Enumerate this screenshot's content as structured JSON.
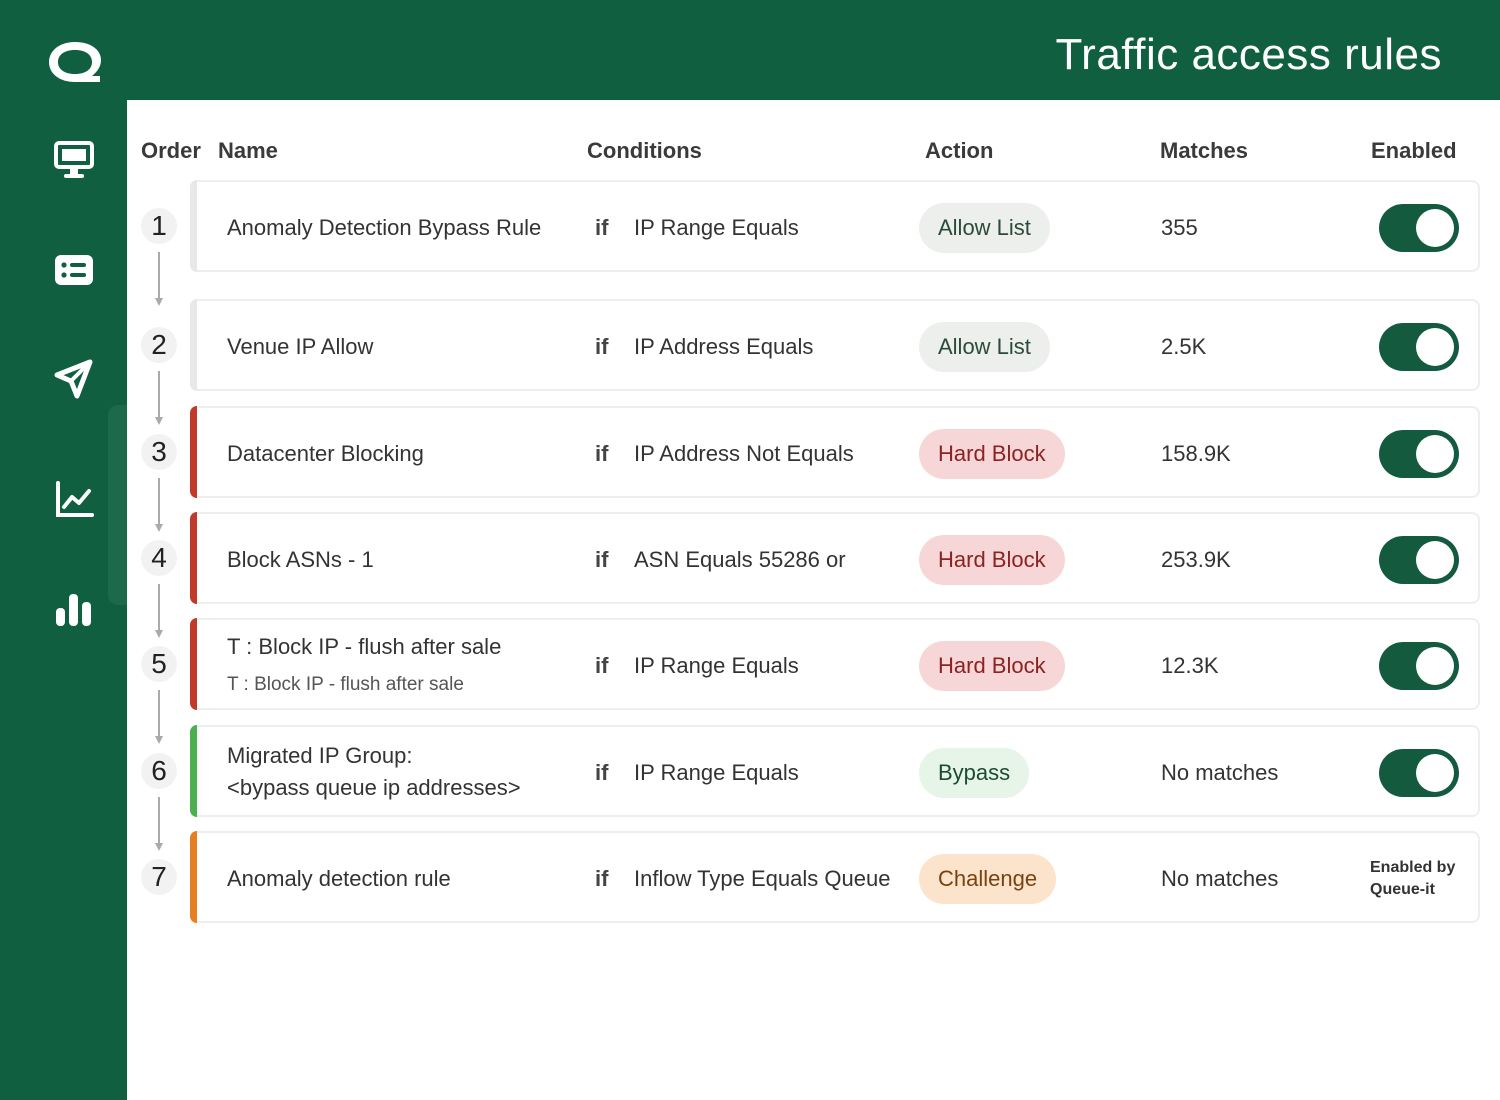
{
  "header": {
    "title": "Traffic access rules"
  },
  "sidebar": {
    "items": [
      {
        "icon": "monitor-icon"
      },
      {
        "icon": "list-icon"
      },
      {
        "icon": "send-icon"
      },
      {
        "icon": "line-chart-icon"
      },
      {
        "icon": "bar-chart-icon"
      }
    ]
  },
  "table": {
    "headers": {
      "order": "Order",
      "name": "Name",
      "conditions": "Conditions",
      "action": "Action",
      "matches": "Matches",
      "enabled": "Enabled"
    },
    "rows": [
      {
        "order": "1",
        "name": "Anomaly Detection Bypass Rule",
        "if": "if",
        "condition": "IP Range Equals",
        "action": "Allow List",
        "matches": "355",
        "enabled": true
      },
      {
        "order": "2",
        "name": "Venue IP Allow",
        "if": "if",
        "condition": "IP Address Equals",
        "action": "Allow List",
        "matches": "2.5K",
        "enabled": true
      },
      {
        "order": "3",
        "name": "Datacenter Blocking",
        "if": "if",
        "condition": "IP Address Not Equals",
        "action": "Hard Block",
        "matches": "158.9K",
        "enabled": true
      },
      {
        "order": "4",
        "name": "Block ASNs - 1",
        "if": "if",
        "condition": "ASN Equals 55286 or",
        "action": "Hard Block",
        "matches": "253.9K",
        "enabled": true
      },
      {
        "order": "5",
        "name": "T : Block IP - flush after sale",
        "subname": "T : Block IP - flush after sale",
        "if": "if",
        "condition": "IP Range Equals",
        "action": "Hard Block",
        "matches": "12.3K",
        "enabled": true
      },
      {
        "order": "6",
        "name": "Migrated IP Group:",
        "subname": "<bypass queue ip addresses>",
        "if": "if",
        "condition": "IP Range Equals",
        "action": "Bypass",
        "matches": "No matches",
        "enabled": true
      },
      {
        "order": "7",
        "name": "Anomaly detection rule",
        "if": "if",
        "condition": "Inflow Type Equals Queue",
        "action": "Challenge",
        "matches": "No matches",
        "enabled_by_1": "Enabled by",
        "enabled_by_2": "Queue-it"
      }
    ]
  },
  "colors": {
    "brand": "#0f5f40",
    "toggle": "#145a3e",
    "allow_pill_bg": "#ecefec",
    "block_pill_bg": "#f6d6d6",
    "block_text": "#8c2323",
    "block_accent": "#c0392b",
    "bypass_pill_bg": "#e6f5e8",
    "bypass_text": "#1d4b32",
    "bypass_accent": "#4caf50",
    "challenge_pill_bg": "#fbe3cc",
    "challenge_text": "#7a4210",
    "challenge_accent": "#e67e22"
  }
}
